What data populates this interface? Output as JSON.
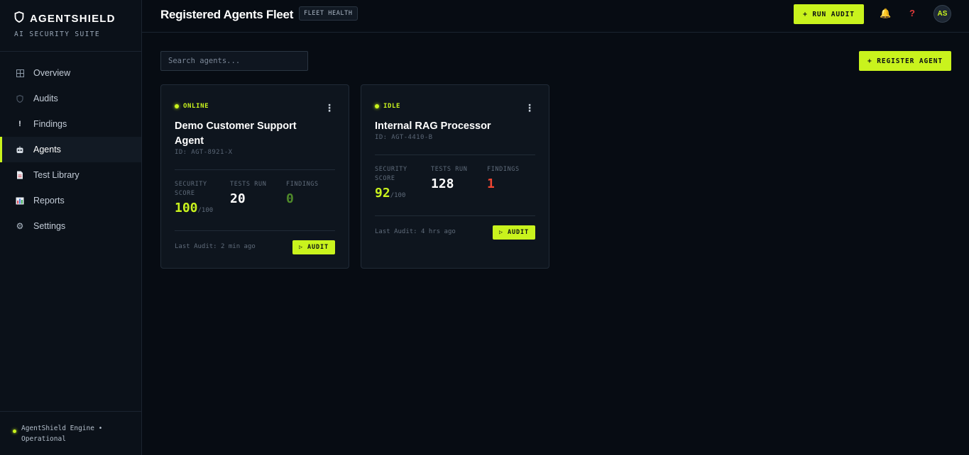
{
  "brand": {
    "name": "AGENTSHIELD",
    "subtitle": "AI SECURITY SUITE"
  },
  "nav": [
    {
      "label": "Overview",
      "icon": "grid-icon"
    },
    {
      "label": "Audits",
      "icon": "shield-icon"
    },
    {
      "label": "Findings",
      "icon": "exclamation-icon"
    },
    {
      "label": "Agents",
      "icon": "robot-icon",
      "active": true
    },
    {
      "label": "Test Library",
      "icon": "document-icon"
    },
    {
      "label": "Reports",
      "icon": "bar-chart-icon"
    },
    {
      "label": "Settings",
      "icon": "gear-icon"
    }
  ],
  "sidebar_footer": "AgentShield Engine • Operational",
  "header": {
    "title": "Registered Agents Fleet",
    "badge": "FLEET HEALTH",
    "run_audit": "+ RUN AUDIT",
    "avatar": "AS"
  },
  "search": {
    "placeholder": "Search agents..."
  },
  "register_button": "+ REGISTER AGENT",
  "stat_labels": {
    "score": "SECURITY SCORE",
    "tests": "TESTS RUN",
    "findings": "FINDINGS"
  },
  "agents": [
    {
      "status": "ONLINE",
      "name": "Demo Customer Support Agent",
      "id": "ID: AGT-8921-X",
      "score": "100",
      "score_max": "/100",
      "tests": "20",
      "findings": "0",
      "last_audit": "Last Audit: 2 min ago",
      "audit_label": "▷ AUDIT"
    },
    {
      "status": "IDLE",
      "name": "Internal RAG Processor",
      "id": "ID: AGT-4410-B",
      "score": "92",
      "score_max": "/100",
      "tests": "128",
      "findings": "1",
      "last_audit": "Last Audit: 4 hrs ago",
      "audit_label": "▷ AUDIT"
    }
  ],
  "colors": {
    "accent": "#c9f31d",
    "danger": "#ef4632",
    "background": "#070c13"
  }
}
